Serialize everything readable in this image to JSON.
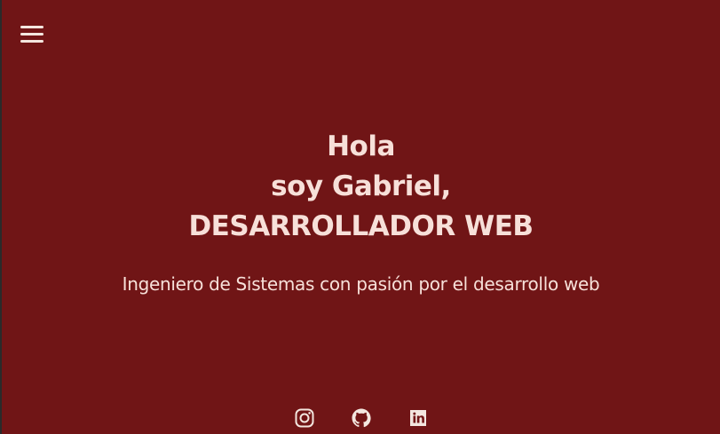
{
  "nav": {
    "menu_icon": "hamburger-menu-icon"
  },
  "hero": {
    "line1": "Hola",
    "line2": "soy Gabriel,",
    "line3": "DESARROLLADOR WEB",
    "subtitle": "Ingeniero de Sistemas con pasión por el desarrollo web"
  },
  "socials": [
    {
      "icon": "instagram-icon"
    },
    {
      "icon": "github-icon"
    },
    {
      "icon": "linkedin-icon"
    }
  ],
  "colors": {
    "background": "#701516",
    "text": "#f7e0d9"
  }
}
